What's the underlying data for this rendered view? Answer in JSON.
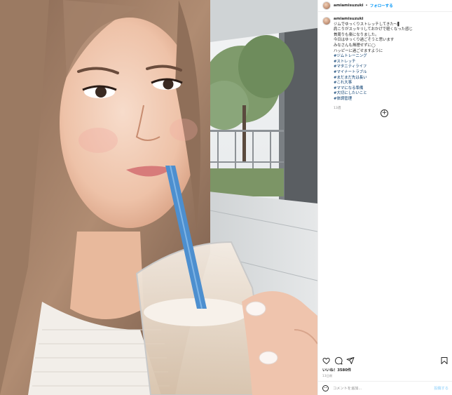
{
  "post": {
    "username": "amiamisuzuki",
    "separator": "•",
    "follow_label": "フォローする"
  },
  "caption": {
    "username": "amiamisuzuki",
    "lines": [
      "ジムでゆっくりストレッチしてきた〜▌",
      "肩こりがスッキリしておかげで軽くなった感じ",
      "首周りも楽になりました。",
      "",
      "今日はゆっくり過ごそうと思います",
      "みなさんも無理せずに◯",
      "ハッピーに過ごせますように",
      "",
      "#ジムトレーニング",
      "#ストレッチ",
      "#マタニティライフ",
      "#マイナートラブル",
      "#まだまだ先は長い",
      "#これ大事",
      "#ママになる準備",
      "#大切にしたいこと",
      "#体調管理"
    ],
    "time": "13週"
  },
  "icons": {
    "like": "heart-icon",
    "comment": "comment-icon",
    "share": "share-icon",
    "save": "bookmark-icon",
    "load_more": "plus-circle-icon",
    "emoji": "emoji-icon"
  },
  "likes": "いいね！3580件",
  "date": "13日前",
  "comment_box": {
    "placeholder": "コメントを追加...",
    "post_label": "投稿する"
  },
  "colors": {
    "link_blue": "#0095f6",
    "hashtag": "#00376b",
    "muted": "#8e8e8e",
    "post_disabled": "#b2dffc"
  }
}
